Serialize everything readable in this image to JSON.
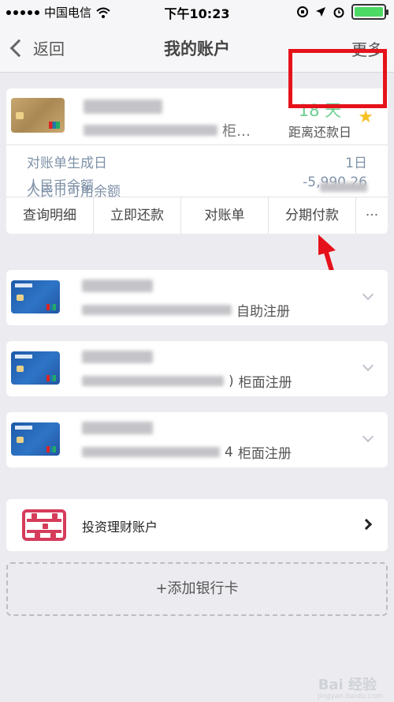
{
  "status_bar": {
    "carrier": "中国电信",
    "time": "下午10:23",
    "icons": [
      "signal-dots-icon",
      "wifi-icon",
      "rotation-lock-icon",
      "location-arrow-icon",
      "alarm-icon",
      "battery-icon"
    ],
    "battery_level": 1.0
  },
  "nav": {
    "back_label": "返回",
    "title": "我的账户",
    "more_label": "更多"
  },
  "primary_card": {
    "days_value": "18 天",
    "days_label": "距离还款日",
    "suffix": "柜…",
    "star_icon": "star-icon",
    "info": [
      {
        "label": "对账单生成日",
        "value": "1日"
      },
      {
        "label": "人民币余额",
        "value": "-5,990.26"
      },
      {
        "label": "人民币可用余额",
        "value": ""
      }
    ],
    "actions": [
      "查询明细",
      "立即还款",
      "对账单",
      "分期付款",
      "···"
    ]
  },
  "cards": [
    {
      "tag": "自助注册"
    },
    {
      "tag": "柜面注册",
      "num_suffix": ")"
    },
    {
      "tag": "柜面注册",
      "num_suffix": "4"
    }
  ],
  "investment": {
    "label": "投资理财账户",
    "icon": "abacus-icon"
  },
  "add_card_label": "+添加银行卡",
  "watermark": {
    "main": "Bai 经验",
    "sub": "jingyan.baidu.com"
  },
  "colors": {
    "accent_green": "#6ccf92",
    "annotation_red": "#e6121b",
    "info_text": "#7f92a8",
    "invest_icon": "#d53c5b",
    "star": "#f5c125"
  }
}
